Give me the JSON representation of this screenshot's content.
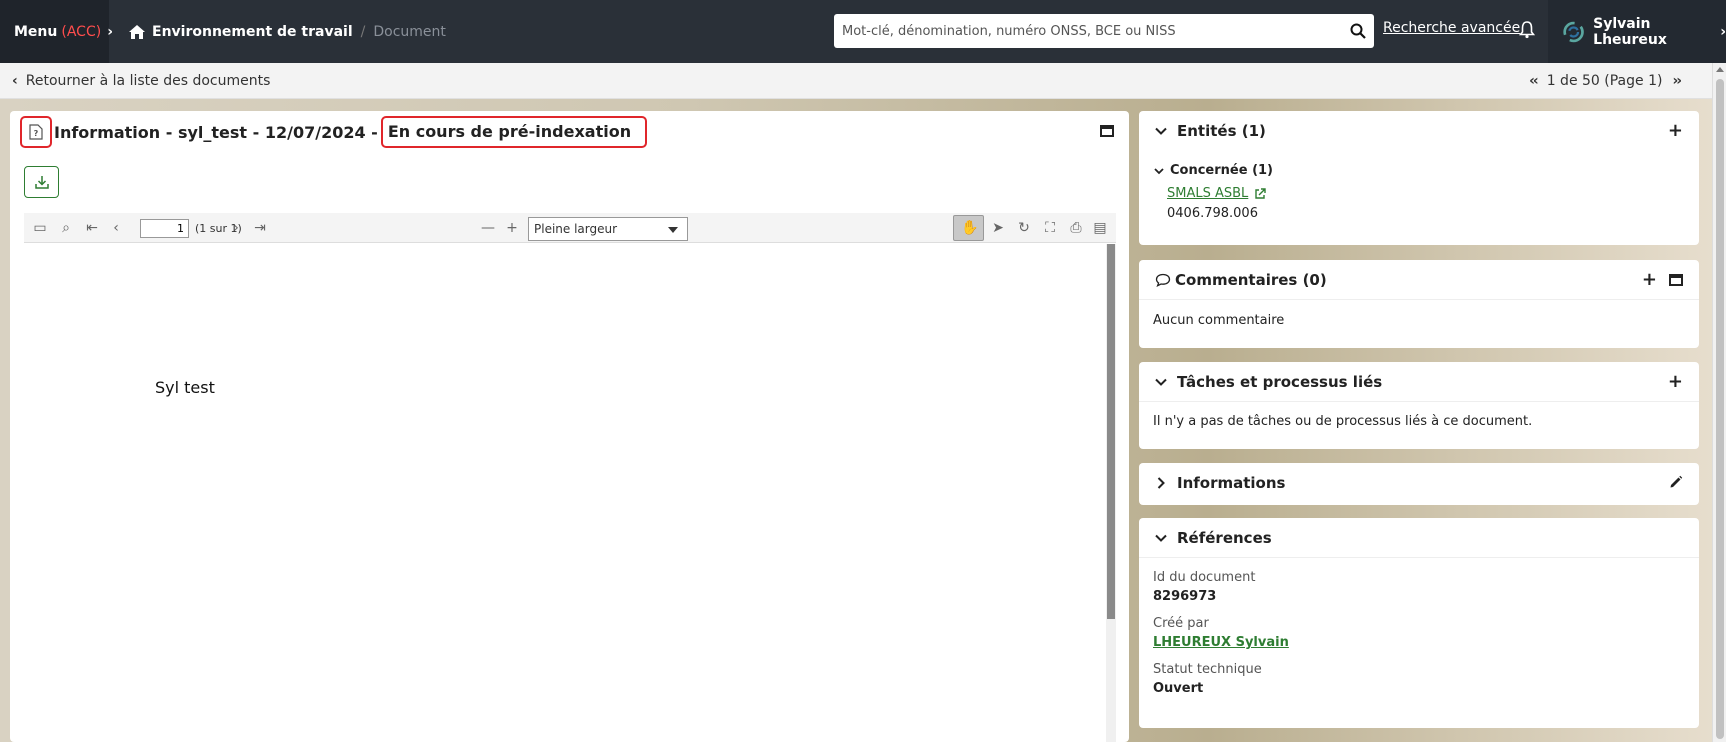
{
  "topbar": {
    "menu_label": "Menu",
    "menu_env": "(ACC)",
    "breadcrumb_home": "Environnement de travail",
    "breadcrumb_sep": "/",
    "breadcrumb_current": "Document",
    "search_placeholder": "Mot-clé, dénomination, numéro ONSS, BCE ou NISS",
    "advanced_search": "Recherche avancée",
    "user_name": "Sylvain Lheureux"
  },
  "subbar": {
    "back_label": "Retourner à la liste des documents",
    "pager_text": "1 de 50 (Page 1)"
  },
  "document": {
    "title": "Information - syl_test - 12/07/2024 -",
    "status": "En cours de pré-indexation",
    "viewer": {
      "page_value": "1",
      "page_total": "(1 sur 1)",
      "zoom": "Pleine largeur",
      "content_text": "Syl test"
    }
  },
  "entities": {
    "title": "Entités (1)",
    "group_label": "Concernée (1)",
    "entity_name": "SMALS ASBL",
    "entity_number": "0406.798.006"
  },
  "comments": {
    "title": "Commentaires (0)",
    "empty_text": "Aucun commentaire"
  },
  "tasks": {
    "title": "Tâches et processus liés",
    "empty_text": "Il n'y a pas de tâches ou de processus liés à ce document."
  },
  "informations": {
    "title": "Informations"
  },
  "references": {
    "title": "Références",
    "doc_id_label": "Id du document",
    "doc_id_value": "8296973",
    "created_by_label": "Créé par",
    "created_by_value": "LHEUREUX Sylvain",
    "status_label": "Statut technique",
    "status_value": "Ouvert"
  },
  "colors": {
    "topbar": "#2a3038",
    "accent_red": "#e0262b",
    "link_green": "#2e7d32"
  }
}
